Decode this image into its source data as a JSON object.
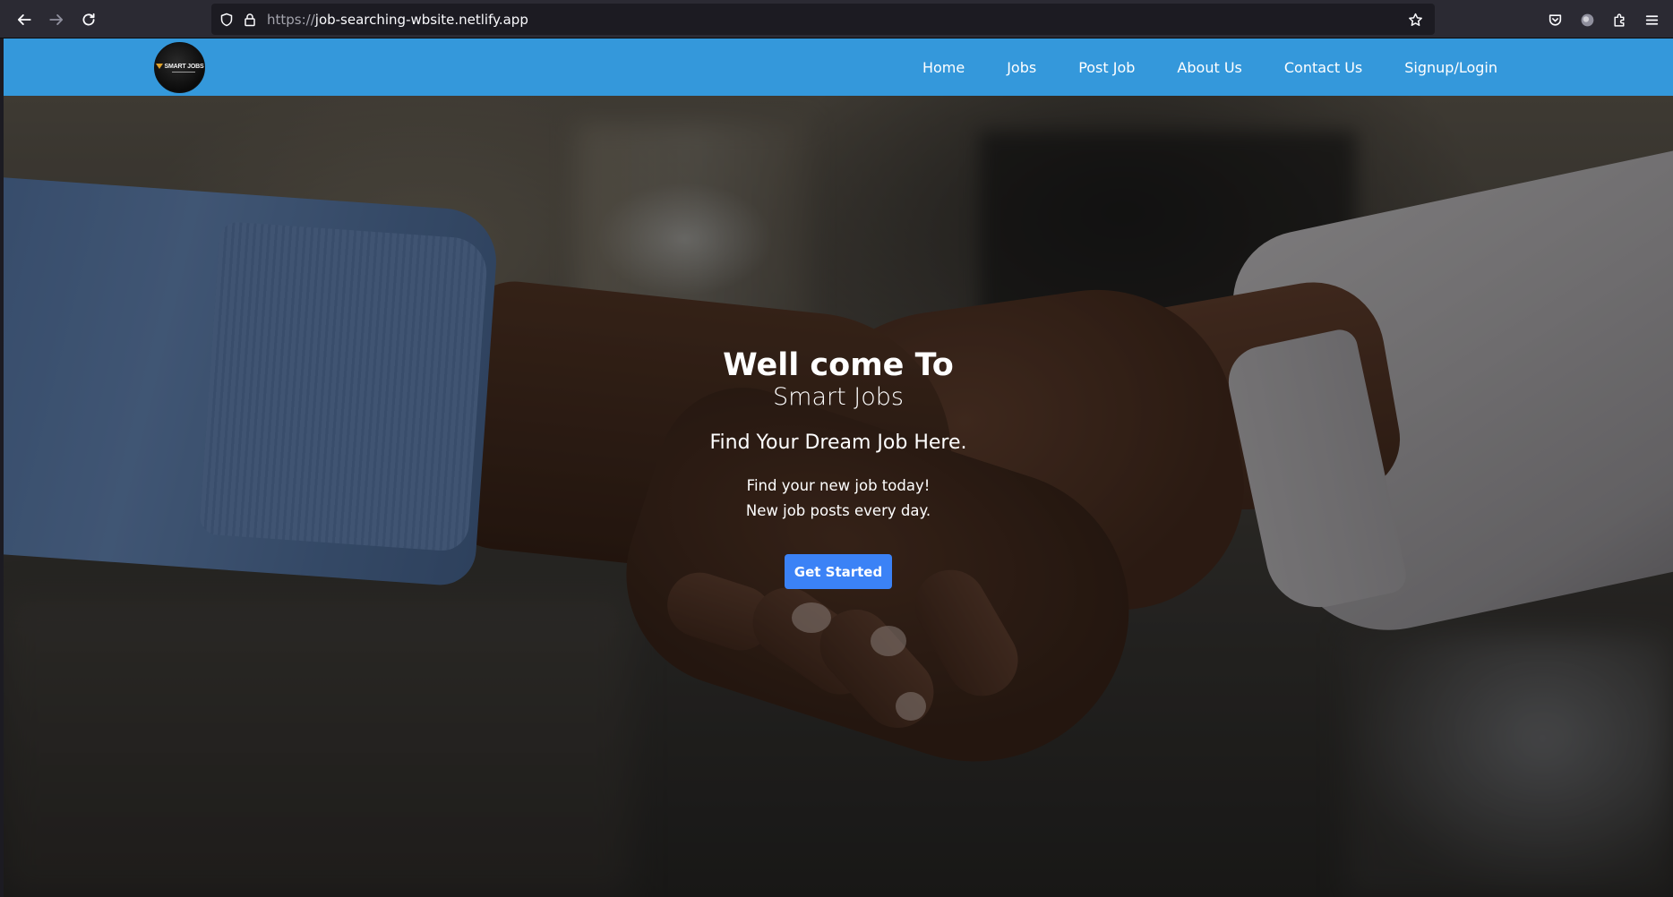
{
  "browser": {
    "url_scheme": "https://",
    "url_host": "job-searching-wbsite.netlify.app",
    "icons": {
      "back": "back-arrow-icon",
      "forward": "forward-arrow-icon",
      "reload": "reload-icon",
      "tracking": "shield-icon",
      "lock": "lock-icon",
      "bookmark": "star-icon",
      "pocket": "pocket-icon",
      "account": "account-icon",
      "extensions": "puzzle-icon",
      "menu": "hamburger-menu-icon"
    }
  },
  "site": {
    "logo_text": "SMART JOBS",
    "nav": {
      "items": [
        {
          "label": "Home"
        },
        {
          "label": "Jobs"
        },
        {
          "label": "Post Job"
        },
        {
          "label": "About Us"
        },
        {
          "label": "Contact Us"
        },
        {
          "label": "Signup/Login"
        }
      ]
    },
    "colors": {
      "nav_background": "#3498db",
      "button_background": "#3b82f6",
      "text": "#ffffff"
    }
  },
  "hero": {
    "title": "Well come To",
    "subtitle": "Smart Jobs",
    "tagline": "Find Your Dream Job Here.",
    "line1": "Find your new job today!",
    "line2": "New job posts every day.",
    "button_label": "Get Started"
  }
}
